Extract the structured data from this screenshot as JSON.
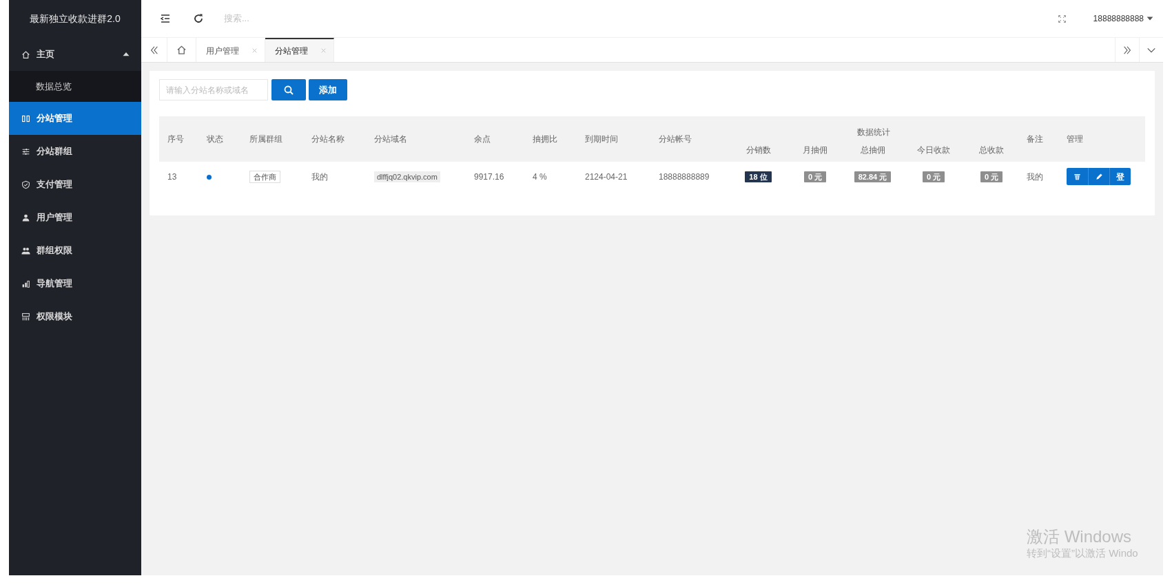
{
  "sidebar": {
    "title": "最新独立收款进群2.0",
    "items": [
      {
        "label": "主页",
        "expanded": true,
        "selected": false,
        "children": [
          {
            "label": "数据总览",
            "selected": false
          }
        ]
      },
      {
        "label": "分站管理",
        "selected": true
      },
      {
        "label": "分站群组",
        "selected": false
      },
      {
        "label": "支付管理",
        "selected": false
      },
      {
        "label": "用户管理",
        "selected": false
      },
      {
        "label": "群组权限",
        "selected": false
      },
      {
        "label": "导航管理",
        "selected": false
      },
      {
        "label": "权限模块",
        "selected": false
      }
    ]
  },
  "header": {
    "search_placeholder": "搜索...",
    "user": "18888888888"
  },
  "tabs": [
    {
      "label": "用户管理",
      "selected": false
    },
    {
      "label": "分站管理",
      "selected": true
    }
  ],
  "toolbar": {
    "search_placeholder": "请输入分站名称或域名",
    "add_button": "添加"
  },
  "table": {
    "columns_before": [
      "序号",
      "状态",
      "所属群组",
      "分站名称",
      "分站域名",
      "余点",
      "抽拥比",
      "到期时间",
      "分站帐号"
    ],
    "column_group": {
      "label": "数据统计",
      "columns": [
        "分销数",
        "月抽佣",
        "总抽佣",
        "今日收款",
        "总收款"
      ]
    },
    "columns_after": [
      "备注",
      "管理"
    ],
    "rows": [
      {
        "id": "13",
        "color": "#0a6fcc",
        "group": "合作商",
        "name": "我的",
        "domain": "dlffjq02.qkvip.com",
        "points": "9917.16",
        "ratio": "4 %",
        "expires": "2124-04-21",
        "account": "18888888889",
        "stats": [
          {
            "text": "18 位",
            "kind": "dark"
          },
          {
            "text": "0 元",
            "kind": "muted"
          },
          {
            "text": "82.84 元",
            "kind": "muted"
          },
          {
            "text": "0 元",
            "kind": "muted"
          },
          {
            "text": "0 元",
            "kind": "muted"
          }
        ],
        "note": "我的",
        "actions": [
          {
            "kind": "delete"
          },
          {
            "kind": "edit"
          },
          {
            "kind": "text",
            "label": "登"
          }
        ]
      }
    ]
  },
  "os_overlay": {
    "activation_title": "激活 Windows",
    "activation_hint": "转到“设置”以激活 Windo"
  }
}
